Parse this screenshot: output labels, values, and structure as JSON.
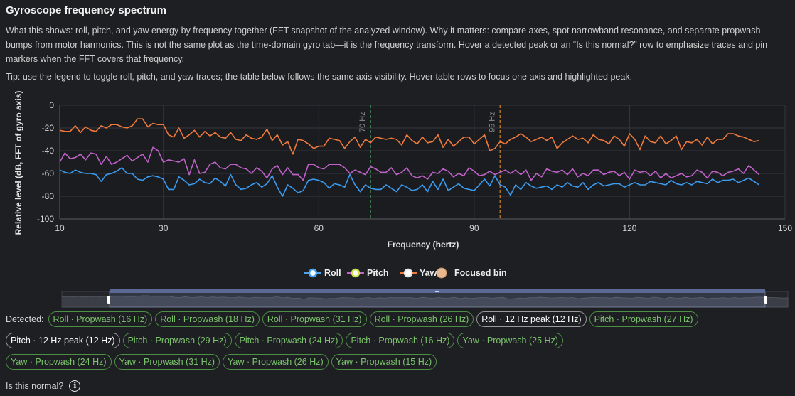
{
  "page": {
    "title": "Gyroscope frequency spectrum",
    "description": "What this shows: roll, pitch, and yaw energy by frequency together (FFT snapshot of the analyzed window). Why it matters: compare axes, spot narrowband resonance, and separate propwash bumps from motor harmonics. This is not the same plot as the time-domain gyro tab—it is the frequency transform. Hover a detected peak or an “Is this normal?” row to emphasize traces and pin markers when the FFT covers that frequency.",
    "tip": "Tip: use the legend to toggle roll, pitch, and yaw traces; the table below follows the same axis visibility. Hover table rows to focus one axis and highlighted peak.",
    "detected_label": "Detected:",
    "is_normal_label": "Is this normal?",
    "info_icon_glyph": "i"
  },
  "chips": [
    {
      "label": "Roll · Propwash (16 Hz)",
      "active": false
    },
    {
      "label": "Roll · Propwash (18 Hz)",
      "active": false
    },
    {
      "label": "Roll · Propwash (31 Hz)",
      "active": false
    },
    {
      "label": "Roll · Propwash (26 Hz)",
      "active": false
    },
    {
      "label": "Roll · 12 Hz peak (12 Hz)",
      "active": true
    },
    {
      "label": "Pitch · Propwash (27 Hz)",
      "active": false
    },
    {
      "label": "Pitch · 12 Hz peak (12 Hz)",
      "active": true
    },
    {
      "label": "Pitch · Propwash (29 Hz)",
      "active": false
    },
    {
      "label": "Pitch · Propwash (24 Hz)",
      "active": false
    },
    {
      "label": "Pitch · Propwash (16 Hz)",
      "active": false
    },
    {
      "label": "Yaw · Propwash (25 Hz)",
      "active": false
    },
    {
      "label": "Yaw · Propwash (24 Hz)",
      "active": false
    },
    {
      "label": "Yaw · Propwash (31 Hz)",
      "active": false
    },
    {
      "label": "Yaw · Propwash (26 Hz)",
      "active": false
    },
    {
      "label": "Yaw · Propwash (15 Hz)",
      "active": false
    }
  ],
  "chart_data": {
    "type": "line",
    "xlabel": "Frequency (hertz)",
    "ylabel": "Relative level (dB, FFT of gyro axis)",
    "xlim": [
      10,
      150
    ],
    "ylim": [
      -100,
      0
    ],
    "xticks": [
      10,
      30,
      60,
      90,
      120,
      150
    ],
    "yticks": [
      0,
      -20,
      -40,
      -60,
      -80,
      -100
    ],
    "grid": true,
    "legend_position": "bottom-center",
    "markers": [
      {
        "x": 70,
        "label": "70 Hz",
        "color": "#3f7f4f"
      },
      {
        "x": 95,
        "label": "95 Hz",
        "color": "#b0702c"
      }
    ],
    "legend": [
      {
        "name": "Roll",
        "color": "#4ea3f0"
      },
      {
        "name": "Pitch",
        "color": "#c9e24a"
      },
      {
        "name": "Yaw",
        "color": "#e8e8e8"
      },
      {
        "name": "Focused bin",
        "color": "#e8b98f"
      }
    ],
    "x_step": 1,
    "series": [
      {
        "name": "Roll",
        "color": "#f07a3c",
        "values": [
          -22,
          -23,
          -23,
          -18,
          -24,
          -19,
          -22,
          -23,
          -18,
          -20,
          -17,
          -17,
          -19,
          -20,
          -18,
          -12,
          -12,
          -19,
          -16,
          -17,
          -17,
          -26,
          -28,
          -20,
          -29,
          -26,
          -22,
          -28,
          -23,
          -27,
          -24,
          -28,
          -29,
          -24,
          -30,
          -31,
          -26,
          -29,
          -30,
          -28,
          -21,
          -31,
          -26,
          -35,
          -32,
          -43,
          -30,
          -31,
          -34,
          -38,
          -36,
          -36,
          -29,
          -30,
          -31,
          -38,
          -32,
          -28,
          -37,
          -30,
          -33,
          -28,
          -29,
          -30,
          -29,
          -30,
          -35,
          -26,
          -31,
          -34,
          -28,
          -33,
          -32,
          -26,
          -37,
          -30,
          -36,
          -32,
          -28,
          -28,
          -34,
          -30,
          -26,
          -40,
          -38,
          -32,
          -34,
          -30,
          -28,
          -25,
          -28,
          -32,
          -30,
          -28,
          -31,
          -28,
          -38,
          -33,
          -30,
          -27,
          -30,
          -29,
          -33,
          -26,
          -30,
          -31,
          -34,
          -27,
          -30,
          -36,
          -25,
          -30,
          -39,
          -27,
          -32,
          -33,
          -27,
          -34,
          -31,
          -27,
          -39,
          -32,
          -33,
          -30,
          -35,
          -28,
          -34,
          -30,
          -30,
          -25,
          -25,
          -27,
          -28,
          -30,
          -32,
          -31
        ]
      },
      {
        "name": "Pitch",
        "color": "#c062c8",
        "values": [
          -50,
          -42,
          -47,
          -46,
          -43,
          -48,
          -42,
          -43,
          -52,
          -45,
          -52,
          -50,
          -47,
          -44,
          -49,
          -46,
          -43,
          -50,
          -37,
          -40,
          -50,
          -48,
          -49,
          -50,
          -47,
          -61,
          -48,
          -60,
          -59,
          -52,
          -50,
          -55,
          -56,
          -52,
          -52,
          -55,
          -56,
          -60,
          -55,
          -58,
          -64,
          -56,
          -53,
          -61,
          -55,
          -61,
          -61,
          -66,
          -52,
          -52,
          -55,
          -56,
          -52,
          -52,
          -52,
          -55,
          -60,
          -57,
          -59,
          -61,
          -54,
          -56,
          -59,
          -59,
          -55,
          -61,
          -59,
          -55,
          -62,
          -64,
          -62,
          -65,
          -59,
          -60,
          -56,
          -58,
          -63,
          -60,
          -62,
          -55,
          -58,
          -62,
          -61,
          -58,
          -61,
          -59,
          -57,
          -60,
          -57,
          -61,
          -57,
          -66,
          -60,
          -63,
          -56,
          -58,
          -59,
          -57,
          -61,
          -56,
          -63,
          -60,
          -62,
          -57,
          -57,
          -61,
          -59,
          -58,
          -62,
          -59,
          -65,
          -57,
          -59,
          -58,
          -62,
          -58,
          -64,
          -60,
          -64,
          -62,
          -60,
          -63,
          -62,
          -57,
          -59,
          -64,
          -58,
          -59,
          -62,
          -59,
          -58,
          -56,
          -60,
          -53,
          -57,
          -61
        ]
      },
      {
        "name": "Yaw",
        "color": "#3a9cf0",
        "values": [
          -57,
          -59,
          -60,
          -57,
          -59,
          -60,
          -60,
          -61,
          -67,
          -61,
          -60,
          -58,
          -55,
          -60,
          -60,
          -65,
          -66,
          -63,
          -62,
          -63,
          -65,
          -74,
          -74,
          -63,
          -66,
          -70,
          -69,
          -65,
          -68,
          -69,
          -64,
          -67,
          -71,
          -61,
          -70,
          -74,
          -73,
          -70,
          -68,
          -72,
          -69,
          -62,
          -72,
          -80,
          -70,
          -73,
          -77,
          -75,
          -66,
          -65,
          -66,
          -68,
          -73,
          -69,
          -70,
          -72,
          -61,
          -70,
          -76,
          -70,
          -73,
          -74,
          -74,
          -70,
          -73,
          -76,
          -70,
          -72,
          -75,
          -74,
          -70,
          -76,
          -67,
          -74,
          -65,
          -75,
          -72,
          -69,
          -73,
          -74,
          -75,
          -70,
          -65,
          -71,
          -62,
          -70,
          -72,
          -79,
          -70,
          -74,
          -68,
          -71,
          -73,
          -72,
          -71,
          -74,
          -70,
          -72,
          -68,
          -71,
          -72,
          -68,
          -74,
          -70,
          -68,
          -71,
          -70,
          -69,
          -69,
          -72,
          -70,
          -68,
          -70,
          -70,
          -67,
          -68,
          -69,
          -70,
          -66,
          -69,
          -70,
          -68,
          -70,
          -67,
          -68,
          -69,
          -65,
          -68,
          -66,
          -66,
          -65,
          -68,
          -66,
          -64,
          -67,
          -70
        ]
      }
    ]
  }
}
